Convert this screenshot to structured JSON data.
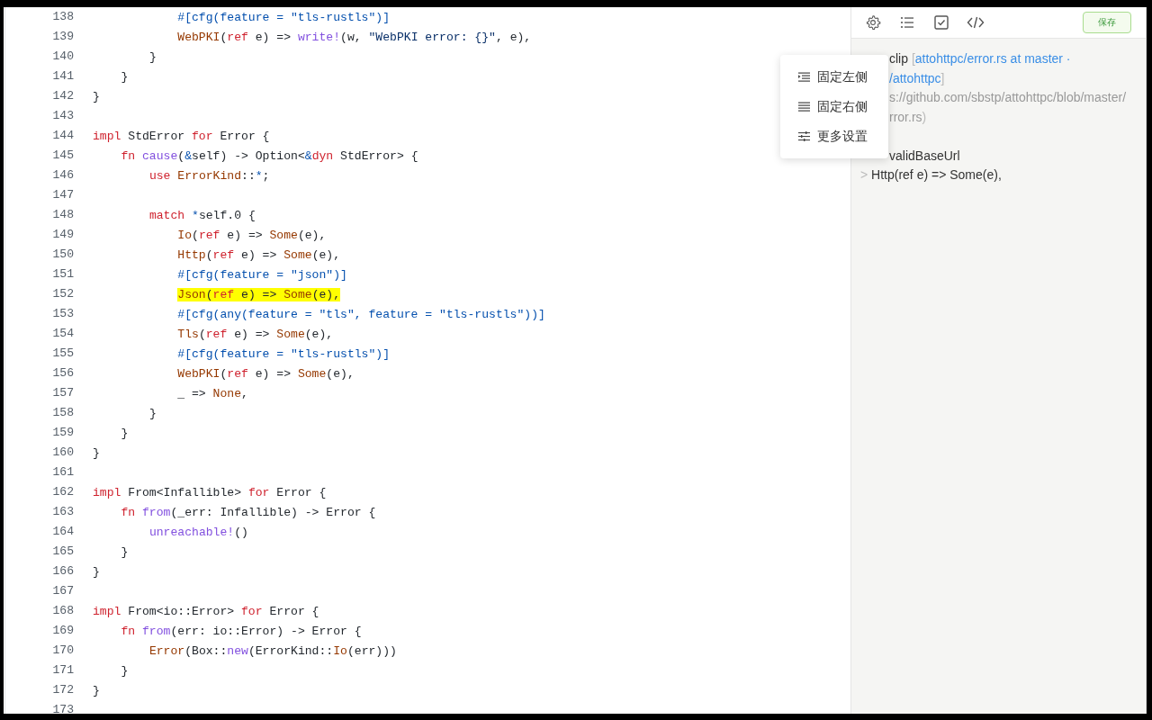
{
  "code": {
    "lines": [
      {
        "num": "138",
        "highlighted": false,
        "tokens": [
          {
            "text": "            #[cfg(feature = \"tls-rustls\")]",
            "kind": "attr"
          }
        ]
      },
      {
        "num": "139",
        "highlighted": false,
        "tokens": [
          {
            "text": "            WebPKI",
            "kind": "type"
          },
          {
            "text": "(",
            "kind": "plain"
          },
          {
            "text": "ref",
            "kind": "keyword"
          },
          {
            "text": " e) => ",
            "kind": "plain"
          },
          {
            "text": "write!",
            "kind": "func"
          },
          {
            "text": "(w, ",
            "kind": "plain"
          },
          {
            "text": "\"WebPKI error: {}\"",
            "kind": "string"
          },
          {
            "text": ", e),",
            "kind": "plain"
          }
        ]
      },
      {
        "num": "140",
        "highlighted": false,
        "tokens": [
          {
            "text": "        }",
            "kind": "plain"
          }
        ]
      },
      {
        "num": "141",
        "highlighted": false,
        "tokens": [
          {
            "text": "    }",
            "kind": "plain"
          }
        ]
      },
      {
        "num": "142",
        "highlighted": false,
        "tokens": [
          {
            "text": "}",
            "kind": "plain"
          }
        ]
      },
      {
        "num": "143"
      },
      {
        "num": "144",
        "highlighted": false,
        "tokens": [
          {
            "text": "impl",
            "kind": "keyword"
          },
          {
            "text": " StdError ",
            "kind": "plain"
          },
          {
            "text": "for",
            "kind": "keyword"
          },
          {
            "text": " Error {",
            "kind": "plain"
          }
        ]
      },
      {
        "num": "145",
        "highlighted": false,
        "tokens": [
          {
            "text": "    fn",
            "kind": "keyword"
          },
          {
            "text": " cause",
            "kind": "func"
          },
          {
            "text": "(",
            "kind": "plain"
          },
          {
            "text": "&",
            "kind": "attr"
          },
          {
            "text": "self) -> Option<",
            "kind": "plain"
          },
          {
            "text": "&",
            "kind": "attr"
          },
          {
            "text": "dyn",
            "kind": "keyword"
          },
          {
            "text": " StdError> {",
            "kind": "plain"
          }
        ]
      },
      {
        "num": "146",
        "highlighted": false,
        "tokens": [
          {
            "text": "        use",
            "kind": "keyword"
          },
          {
            "text": " ErrorKind",
            "kind": "type"
          },
          {
            "text": "::",
            "kind": "plain"
          },
          {
            "text": "*",
            "kind": "attr"
          },
          {
            "text": ";",
            "kind": "plain"
          }
        ]
      },
      {
        "num": "147"
      },
      {
        "num": "148",
        "highlighted": false,
        "tokens": [
          {
            "text": "        match",
            "kind": "keyword"
          },
          {
            "text": " *",
            "kind": "attr"
          },
          {
            "text": "self.0 {",
            "kind": "plain"
          }
        ]
      },
      {
        "num": "149",
        "highlighted": false,
        "tokens": [
          {
            "text": "            Io",
            "kind": "type"
          },
          {
            "text": "(",
            "kind": "plain"
          },
          {
            "text": "ref",
            "kind": "keyword"
          },
          {
            "text": " e) => ",
            "kind": "plain"
          },
          {
            "text": "Some",
            "kind": "type"
          },
          {
            "text": "(e),",
            "kind": "plain"
          }
        ]
      },
      {
        "num": "150",
        "highlighted": false,
        "tokens": [
          {
            "text": "            Http",
            "kind": "type"
          },
          {
            "text": "(",
            "kind": "plain"
          },
          {
            "text": "ref",
            "kind": "keyword"
          },
          {
            "text": " e) => ",
            "kind": "plain"
          },
          {
            "text": "Some",
            "kind": "type"
          },
          {
            "text": "(e),",
            "kind": "plain"
          }
        ]
      },
      {
        "num": "151",
        "highlighted": false,
        "tokens": [
          {
            "text": "            #[cfg(feature = \"json\")]",
            "kind": "attr"
          }
        ]
      },
      {
        "num": "152",
        "highlighted": true,
        "tokens": [
          {
            "text": "            Json",
            "kind": "type"
          },
          {
            "text": "(",
            "kind": "plain"
          },
          {
            "text": "ref",
            "kind": "keyword"
          },
          {
            "text": " e) => ",
            "kind": "plain"
          },
          {
            "text": "Some",
            "kind": "type"
          },
          {
            "text": "(e),",
            "kind": "plain"
          }
        ]
      },
      {
        "num": "153",
        "highlighted": false,
        "tokens": [
          {
            "text": "            #[cfg(any(feature = \"tls\", feature = \"tls-rustls\"))]",
            "kind": "attr"
          }
        ]
      },
      {
        "num": "154",
        "highlighted": false,
        "tokens": [
          {
            "text": "            Tls",
            "kind": "type"
          },
          {
            "text": "(",
            "kind": "plain"
          },
          {
            "text": "ref",
            "kind": "keyword"
          },
          {
            "text": " e) => ",
            "kind": "plain"
          },
          {
            "text": "Some",
            "kind": "type"
          },
          {
            "text": "(e),",
            "kind": "plain"
          }
        ]
      },
      {
        "num": "155",
        "highlighted": false,
        "tokens": [
          {
            "text": "            #[cfg(feature = \"tls-rustls\")]",
            "kind": "attr"
          }
        ]
      },
      {
        "num": "156",
        "highlighted": false,
        "tokens": [
          {
            "text": "            WebPKI",
            "kind": "type"
          },
          {
            "text": "(",
            "kind": "plain"
          },
          {
            "text": "ref",
            "kind": "keyword"
          },
          {
            "text": " e) => ",
            "kind": "plain"
          },
          {
            "text": "Some",
            "kind": "type"
          },
          {
            "text": "(e),",
            "kind": "plain"
          }
        ]
      },
      {
        "num": "157",
        "highlighted": false,
        "tokens": [
          {
            "text": "            _ => ",
            "kind": "plain"
          },
          {
            "text": "None",
            "kind": "type"
          },
          {
            "text": ",",
            "kind": "plain"
          }
        ]
      },
      {
        "num": "158",
        "highlighted": false,
        "tokens": [
          {
            "text": "        }",
            "kind": "plain"
          }
        ]
      },
      {
        "num": "159",
        "highlighted": false,
        "tokens": [
          {
            "text": "    }",
            "kind": "plain"
          }
        ]
      },
      {
        "num": "160",
        "highlighted": false,
        "tokens": [
          {
            "text": "}",
            "kind": "plain"
          }
        ]
      },
      {
        "num": "161"
      },
      {
        "num": "162",
        "highlighted": false,
        "tokens": [
          {
            "text": "impl",
            "kind": "keyword"
          },
          {
            "text": " From<Infallible> ",
            "kind": "plain"
          },
          {
            "text": "for",
            "kind": "keyword"
          },
          {
            "text": " Error {",
            "kind": "plain"
          }
        ]
      },
      {
        "num": "163",
        "highlighted": false,
        "tokens": [
          {
            "text": "    fn",
            "kind": "keyword"
          },
          {
            "text": " from",
            "kind": "func"
          },
          {
            "text": "(_err: Infallible) -> Error {",
            "kind": "plain"
          }
        ]
      },
      {
        "num": "164",
        "highlighted": false,
        "tokens": [
          {
            "text": "        unreachable!",
            "kind": "func"
          },
          {
            "text": "()",
            "kind": "plain"
          }
        ]
      },
      {
        "num": "165",
        "highlighted": false,
        "tokens": [
          {
            "text": "    }",
            "kind": "plain"
          }
        ]
      },
      {
        "num": "166",
        "highlighted": false,
        "tokens": [
          {
            "text": "}",
            "kind": "plain"
          }
        ]
      },
      {
        "num": "167"
      },
      {
        "num": "168",
        "highlighted": false,
        "tokens": [
          {
            "text": "impl",
            "kind": "keyword"
          },
          {
            "text": " From<io::Error> ",
            "kind": "plain"
          },
          {
            "text": "for",
            "kind": "keyword"
          },
          {
            "text": " Error {",
            "kind": "plain"
          }
        ]
      },
      {
        "num": "169",
        "highlighted": false,
        "tokens": [
          {
            "text": "    fn",
            "kind": "keyword"
          },
          {
            "text": " from",
            "kind": "func"
          },
          {
            "text": "(err: io::Error) -> Error {",
            "kind": "plain"
          }
        ]
      },
      {
        "num": "170",
        "highlighted": false,
        "tokens": [
          {
            "text": "        Error",
            "kind": "type"
          },
          {
            "text": "(Box::",
            "kind": "plain"
          },
          {
            "text": "new",
            "kind": "func"
          },
          {
            "text": "(ErrorKind::",
            "kind": "plain"
          },
          {
            "text": "Io",
            "kind": "type"
          },
          {
            "text": "(err)))",
            "kind": "plain"
          }
        ]
      },
      {
        "num": "171",
        "highlighted": false,
        "tokens": [
          {
            "text": "    }",
            "kind": "plain"
          }
        ]
      },
      {
        "num": "172",
        "highlighted": false,
        "tokens": [
          {
            "text": "}",
            "kind": "plain"
          }
        ]
      },
      {
        "num": "173"
      }
    ]
  },
  "popup_menu": {
    "items": [
      {
        "label": "固定左侧",
        "kind": "pin-left"
      },
      {
        "label": "固定右侧",
        "kind": "pin-right"
      },
      {
        "label": "更多设置",
        "kind": "settings"
      }
    ]
  },
  "side_panel": {
    "toolbar": {
      "tools": [
        {
          "kind": "settings"
        },
        {
          "kind": "list"
        },
        {
          "kind": "checkbox"
        },
        {
          "kind": "code"
        }
      ],
      "save_button": "保存"
    },
    "note_lines": [
      {
        "parts": [
          {
            "text": "clip ",
            "kind": "plain"
          },
          {
            "text": "[",
            "kind": "muted"
          },
          {
            "text": "attohttpc/error.rs at master ·",
            "kind": "link"
          }
        ]
      },
      {
        "parts": [
          {
            "text": "/attohttpc",
            "kind": "link"
          },
          {
            "text": "]",
            "kind": "muted"
          }
        ]
      },
      {
        "parts": [
          {
            "text": "s://github.com/sbstp/attohttpc/blob/master/",
            "kind": "url"
          }
        ]
      },
      {
        "parts": [
          {
            "text": "rror.rs",
            "kind": "url"
          },
          {
            "text": ")",
            "kind": "muted"
          }
        ]
      },
      {
        "parts": [
          {
            "text": "validBaseUrl",
            "kind": "plain"
          }
        ]
      },
      {
        "parts": [
          {
            "text": ">",
            "kind": "muted"
          },
          {
            "text": " Http(ref e) => Some(e),",
            "kind": "plain"
          }
        ]
      }
    ]
  }
}
